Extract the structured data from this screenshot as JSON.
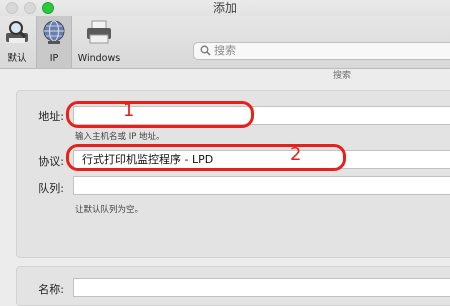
{
  "window": {
    "title": "添加"
  },
  "toolbar": {
    "items": [
      {
        "label": "默认",
        "icon": "magnifier-printer-icon"
      },
      {
        "label": "IP",
        "icon": "globe-icon",
        "selected": true
      },
      {
        "label": "Windows",
        "icon": "printer-icon"
      }
    ],
    "search": {
      "placeholder": "搜索",
      "caption": "搜索"
    }
  },
  "form": {
    "address_label": "地址:",
    "address_value": "",
    "address_hint": "输入主机名或 IP 地址。",
    "protocol_label": "协议:",
    "protocol_value": "行式打印机监控程序 - LPD",
    "queue_label": "队列:",
    "queue_value": "",
    "queue_hint": "让默认队列为空。",
    "name_label": "名称:"
  },
  "annotations": {
    "marker_1": "1",
    "marker_2": "2",
    "color": "#e8201b"
  }
}
